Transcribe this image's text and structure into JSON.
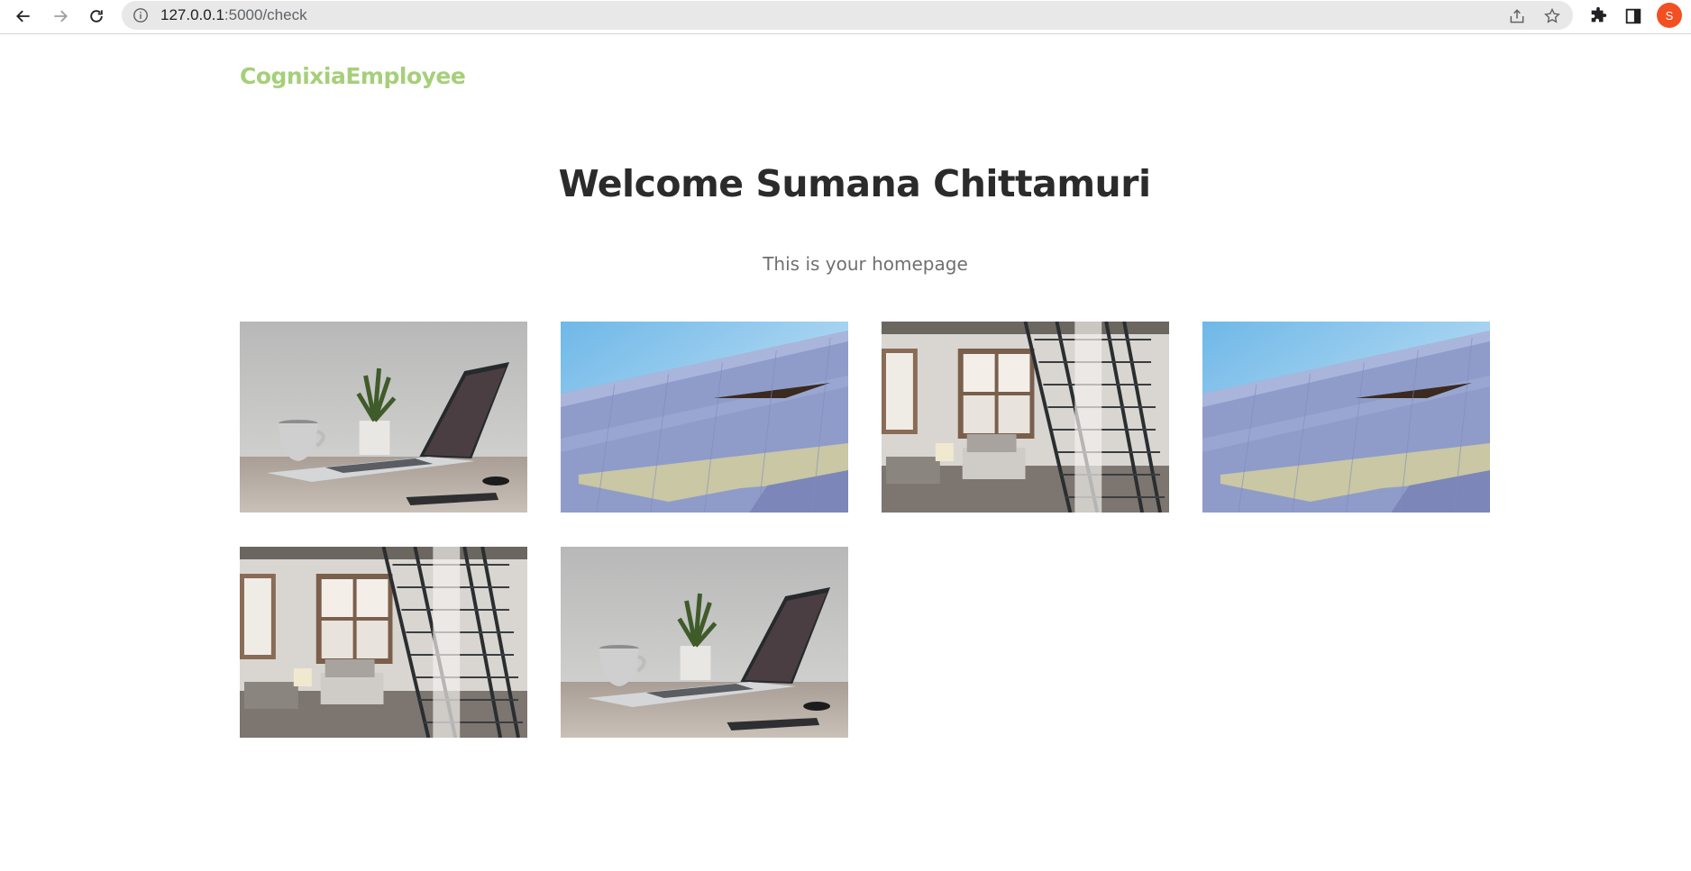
{
  "browser": {
    "url_host": "127.0.0.1",
    "url_rest": ":5000/check",
    "avatar_letter": "S"
  },
  "header": {
    "brand": "CognixiaEmployee"
  },
  "main": {
    "title": "Welcome Sumana Chittamuri",
    "subtitle": "This is your homepage"
  },
  "gallery": {
    "images": [
      {
        "subject": "laptop-desk"
      },
      {
        "subject": "building-facade"
      },
      {
        "subject": "loft-stairs"
      },
      {
        "subject": "building-facade"
      },
      {
        "subject": "loft-stairs"
      },
      {
        "subject": "laptop-desk"
      }
    ]
  },
  "colors": {
    "brand": "#a6cf7a",
    "title": "#2b2b2b",
    "subtitle": "#707070",
    "avatar": "#f25022"
  }
}
